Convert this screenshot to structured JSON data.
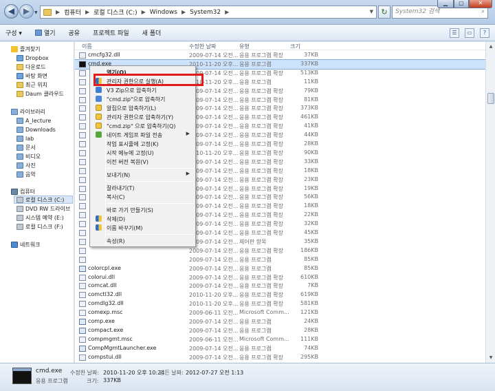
{
  "address": {
    "crumbs": [
      "컴퓨터",
      "로컬 디스크 (C:)",
      "Windows",
      "System32"
    ]
  },
  "search": {
    "placeholder": "System32 검색"
  },
  "toolbar": {
    "organize": "구성 ▾",
    "open": "열기",
    "share": "공유",
    "burn": "프로젝트 파일",
    "new_folder": "새 폴더"
  },
  "nav": {
    "favorites": "즐겨찾기",
    "dropbox": "Dropbox",
    "downloads": "다운로드",
    "desktop": "바탕 화면",
    "recent": "최근 위치",
    "daum": "Daum 클라우드",
    "libraries": "라이브러리",
    "a_lecture": "A_lecture",
    "downloads_lib": "Downloads",
    "lab": "lab",
    "documents": "문서",
    "videos": "비디오",
    "pictures": "사진",
    "music": "음악",
    "computer": "컴퓨터",
    "local_c": "로컬 디스크 (C:)",
    "dvd": "DVD RW 드라이브",
    "sysreserved": "시스템 예약 (E:)",
    "local_f": "로컬 디스크 (F:)",
    "network": "네트워크"
  },
  "columns": {
    "name": "이름",
    "date": "수정한 날짜",
    "type": "유형",
    "size": "크기"
  },
  "files": [
    {
      "name": "cmcfg32.dll",
      "date": "2009-07-14 오전...",
      "type": "응용 프로그램 확장",
      "size": "37KB"
    },
    {
      "name": "cmd.exe",
      "date": "2010-11-20 오후...",
      "type": "응용 프로그램",
      "size": "337KB"
    },
    {
      "name": "",
      "date": "2009-07-14 오전...",
      "type": "응용 프로그램 확장",
      "size": "513KB"
    },
    {
      "name": "",
      "date": "2010-11-20 오후...",
      "type": "응용 프로그램",
      "size": "11KB"
    },
    {
      "name": "",
      "date": "2009-07-14 오전...",
      "type": "응용 프로그램 확장",
      "size": "79KB"
    },
    {
      "name": "",
      "date": "2009-07-14 오전...",
      "type": "응용 프로그램 확장",
      "size": "81KB"
    },
    {
      "name": "",
      "date": "2009-07-14 오전...",
      "type": "응용 프로그램 확장",
      "size": "373KB"
    },
    {
      "name": "",
      "date": "2009-07-14 오전...",
      "type": "응용 프로그램 확장",
      "size": "461KB"
    },
    {
      "name": "",
      "date": "2009-07-14 오전...",
      "type": "응용 프로그램 확장",
      "size": "41KB"
    },
    {
      "name": "",
      "date": "2009-07-14 오전...",
      "type": "응용 프로그램 확장",
      "size": "44KB"
    },
    {
      "name": "",
      "date": "2009-07-14 오전...",
      "type": "응용 프로그램 확장",
      "size": "28KB"
    },
    {
      "name": "",
      "date": "2010-11-20 오후...",
      "type": "응용 프로그램 확장",
      "size": "90KB"
    },
    {
      "name": "",
      "date": "2009-07-14 오전...",
      "type": "응용 프로그램 확장",
      "size": "33KB"
    },
    {
      "name": "",
      "date": "2009-07-14 오전...",
      "type": "응용 프로그램 확장",
      "size": "18KB"
    },
    {
      "name": "",
      "date": "2009-07-14 오전...",
      "type": "응용 프로그램 확장",
      "size": "23KB"
    },
    {
      "name": "",
      "date": "2009-07-14 오전...",
      "type": "응용 프로그램 확장",
      "size": "19KB"
    },
    {
      "name": "",
      "date": "2009-07-14 오전...",
      "type": "응용 프로그램 확장",
      "size": "56KB"
    },
    {
      "name": "",
      "date": "2009-07-14 오전...",
      "type": "응용 프로그램 확장",
      "size": "18KB"
    },
    {
      "name": "",
      "date": "2009-07-14 오전...",
      "type": "응용 프로그램 확장",
      "size": "22KB"
    },
    {
      "name": "",
      "date": "2009-07-14 오전...",
      "type": "응용 프로그램 확장",
      "size": "32KB"
    },
    {
      "name": "",
      "date": "2009-07-14 오전...",
      "type": "응용 프로그램 확장",
      "size": "45KB"
    },
    {
      "name": "",
      "date": "2009-07-14 오전...",
      "type": "제어판 항목",
      "size": "35KB"
    },
    {
      "name": "",
      "date": "2009-07-14 오전...",
      "type": "응용 프로그램 확장",
      "size": "186KB"
    },
    {
      "name": "",
      "date": "2009-07-14 오전...",
      "type": "응용 프로그램",
      "size": "85KB"
    },
    {
      "name": "colorcpl.exe",
      "date": "2009-07-14 오전...",
      "type": "응용 프로그램",
      "size": "85KB"
    },
    {
      "name": "colorui.dll",
      "date": "2009-07-14 오전...",
      "type": "응용 프로그램 확장",
      "size": "610KB"
    },
    {
      "name": "comcat.dll",
      "date": "2009-07-14 오전...",
      "type": "응용 프로그램 확장",
      "size": "7KB"
    },
    {
      "name": "comctl32.dll",
      "date": "2010-11-20 오후...",
      "type": "응용 프로그램 확장",
      "size": "619KB"
    },
    {
      "name": "comdlg32.dll",
      "date": "2010-11-20 오후...",
      "type": "응용 프로그램 확장",
      "size": "581KB"
    },
    {
      "name": "comexp.msc",
      "date": "2009-06-11 오전...",
      "type": "Microsoft Comm...",
      "size": "121KB"
    },
    {
      "name": "comp.exe",
      "date": "2009-07-14 오전...",
      "type": "응용 프로그램",
      "size": "24KB"
    },
    {
      "name": "compact.exe",
      "date": "2009-07-14 오전...",
      "type": "응용 프로그램",
      "size": "28KB"
    },
    {
      "name": "compmgmt.msc",
      "date": "2009-06-11 오전...",
      "type": "Microsoft Comm...",
      "size": "111KB"
    },
    {
      "name": "CompMgmtLauncher.exe",
      "date": "2009-07-14 오전...",
      "type": "응용 프로그램",
      "size": "74KB"
    },
    {
      "name": "compstui.dll",
      "date": "2009-07-14 오전...",
      "type": "응용 프로그램 확장",
      "size": "295KB"
    },
    {
      "name": "ComputerDefaults.exe",
      "date": "2009-07-14 오전...",
      "type": "응용 프로그램",
      "size": "37KB"
    },
    {
      "name": "comrepl.dll",
      "date": "2009-07-14 오전...",
      "type": "응용 프로그램 확장",
      "size": "144KB"
    }
  ],
  "menu": {
    "open": "열기(O)",
    "run_as_admin": "관리자 권한으로 실행(A)",
    "v3_zip": "V3 Zip으로 압축하기",
    "zip_cmd": "\"cmd.zip\"으로 압축하기",
    "alzip": "알집으로 압축하기(L)",
    "admin_zip": "관리자 권한으로 압축하기(Y)",
    "alzip_cmd": "\"cmd.zip\" 으로 압축하기(Q)",
    "netgame": "네이트 게임프 파일 전송",
    "pin_taskbar": "작업 표시줄에 고정(K)",
    "pin_start": "시작 메뉴에 고정(U)",
    "restore": "이전 버전 복원(V)",
    "send_to": "보내기(N)",
    "cut": "잘라내기(T)",
    "copy": "복사(C)",
    "shortcut": "바로 가기 만들기(S)",
    "delete": "삭제(D)",
    "rename": "이름 바꾸기(M)",
    "properties": "속성(R)"
  },
  "details": {
    "name": "cmd.exe",
    "type": "응용 프로그램",
    "modified_label": "수정한 날짜:",
    "modified_value": "2010-11-20 오후 10:24",
    "created_label": "만든 날짜:",
    "created_value": "2012-07-27 오전 1:13",
    "size_label": "크기:",
    "size_value": "337KB"
  },
  "colors": {
    "highlight_box": "#e11a1a",
    "selection": "#cde2fb"
  }
}
